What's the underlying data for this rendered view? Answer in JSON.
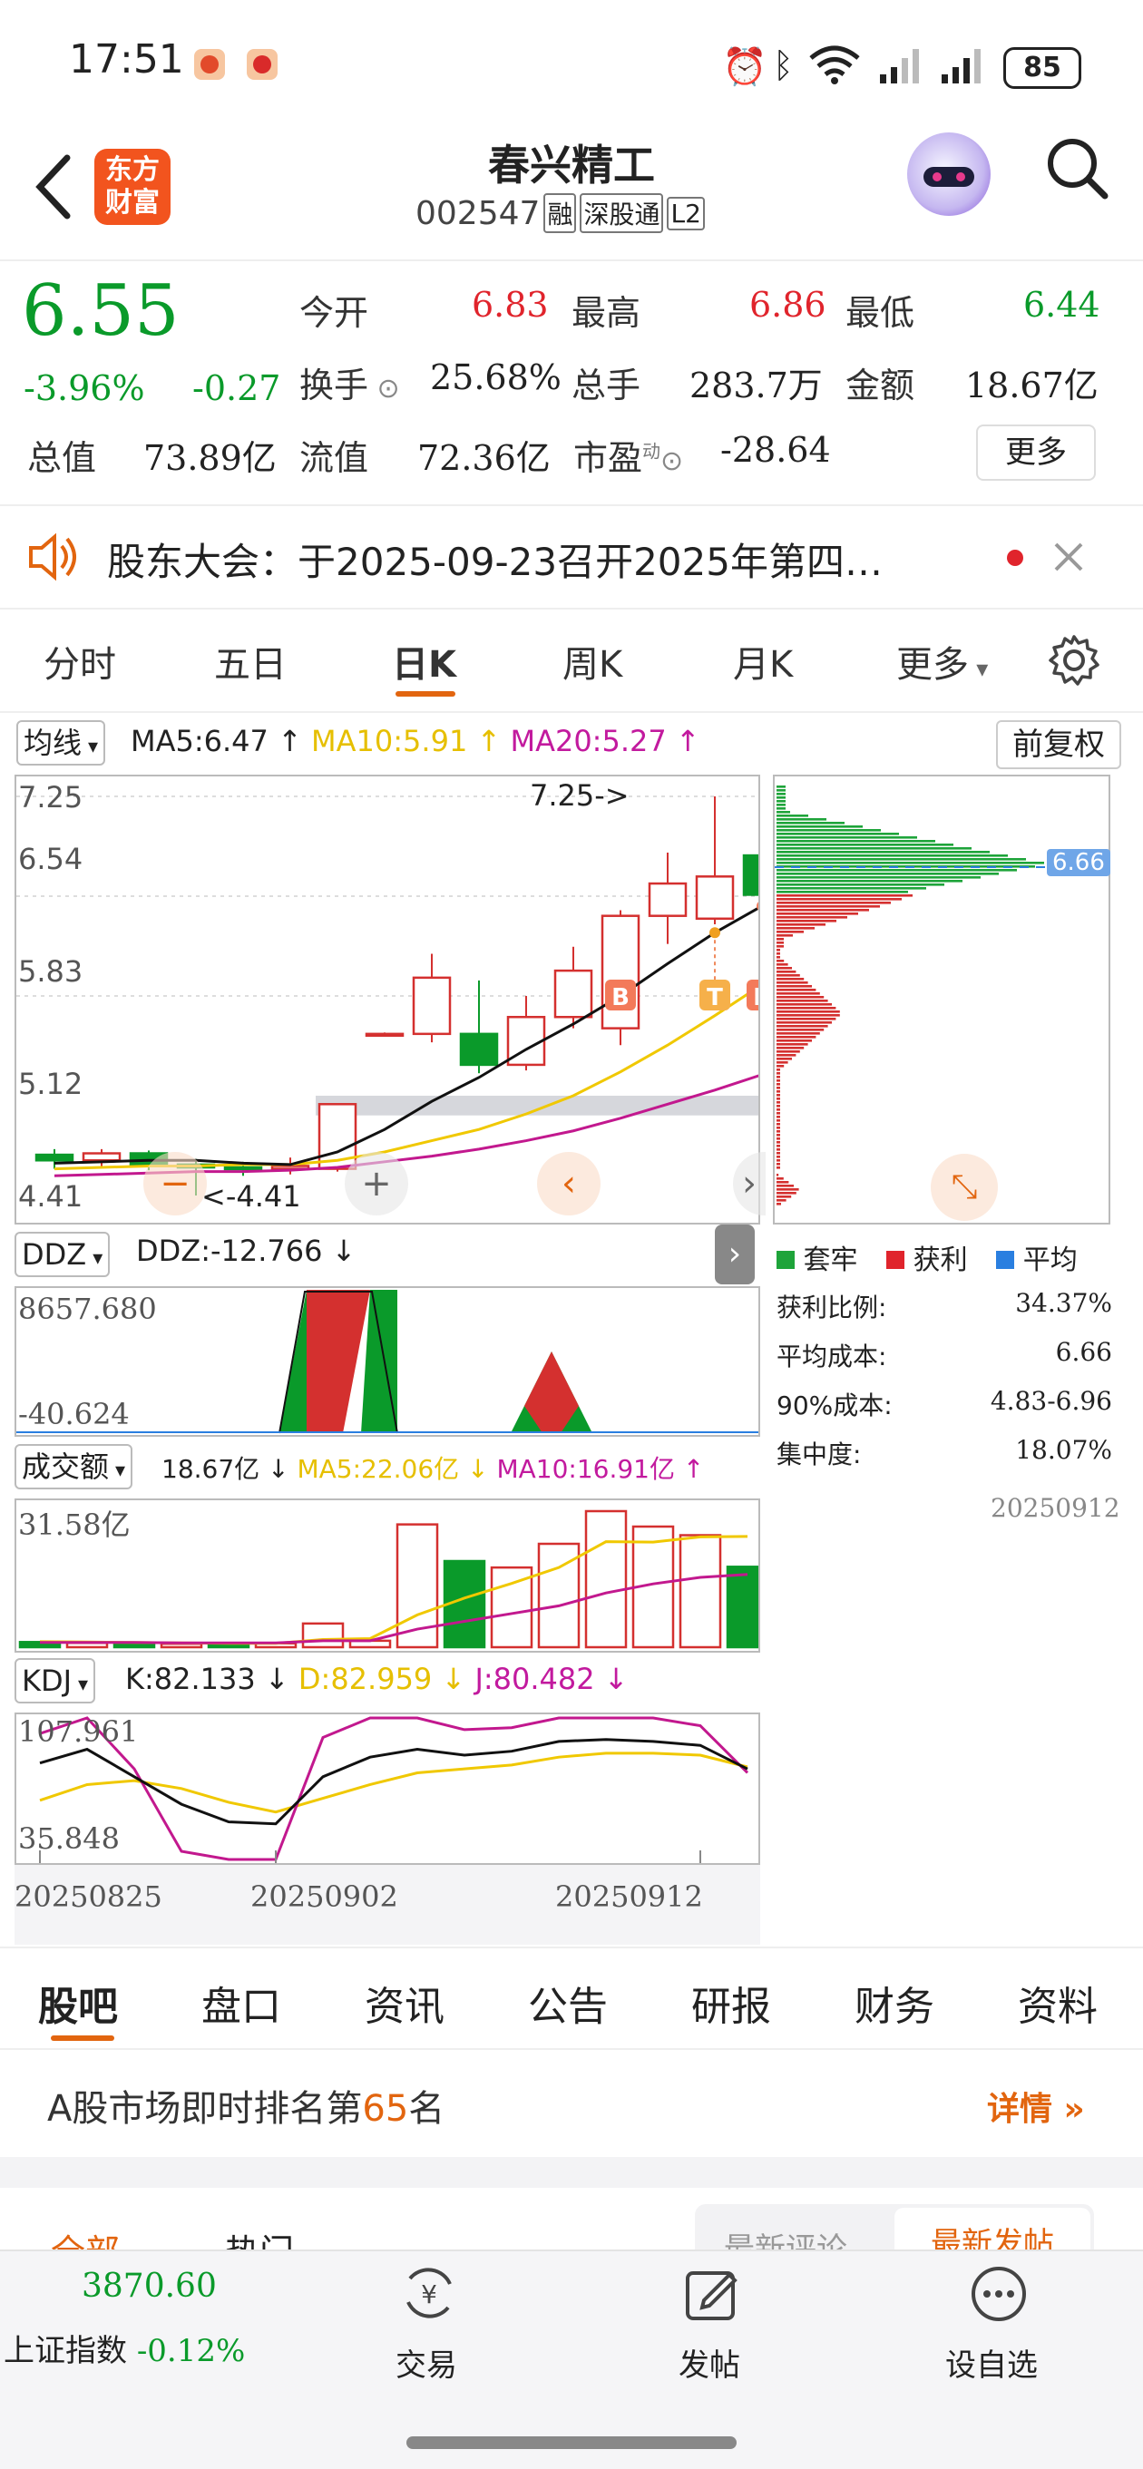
{
  "status_bar": {
    "time": "17:51",
    "battery": "85"
  },
  "header": {
    "title": "春兴精工",
    "code": "002547",
    "badges": [
      "融",
      "深股通",
      "L2"
    ],
    "brand_logo": "东方\n财富"
  },
  "quote": {
    "price": "6.55",
    "change_pct": "-3.96%",
    "change": "-0.27",
    "stats": [
      {
        "label": "今开",
        "value": "6.83",
        "color": "#e0242c"
      },
      {
        "label": "最高",
        "value": "6.86",
        "color": "#e0242c"
      },
      {
        "label": "最低",
        "value": "6.44",
        "color": "#0a9a2a"
      },
      {
        "label": "换手",
        "value": "25.68%",
        "color": "#222222"
      },
      {
        "label": "总手",
        "value": "283.7万",
        "color": "#222222"
      },
      {
        "label": "金额",
        "value": "18.67亿",
        "color": "#222222"
      },
      {
        "label": "总值",
        "value": "73.89亿",
        "color": "#222222"
      },
      {
        "label": "流值",
        "value": "72.36亿",
        "color": "#222222"
      },
      {
        "label": "市盈",
        "value": "-28.64",
        "color": "#222222"
      }
    ],
    "pe_sup": "动",
    "more_button": "更多"
  },
  "notice": {
    "text": "股东大会：于2025-09-23召开2025年第四…"
  },
  "kline_tabs": {
    "items": [
      "分时",
      "五日",
      "日K",
      "周K",
      "月K",
      "更多"
    ],
    "active": 2
  },
  "ma_bar": {
    "selector": "均线",
    "ma5": "MA5:6.47",
    "ma10": "MA10:5.91",
    "ma20": "MA20:5.27",
    "adjust_button": "前复权"
  },
  "chart_data": [
    {
      "type": "candlestick",
      "title": "",
      "ylim": [
        4.41,
        7.25
      ],
      "y_ticks": [
        "7.25",
        "6.54",
        "5.83",
        "5.12",
        "4.41"
      ],
      "annotations": {
        "high": "7.25->",
        "low": "<-4.41"
      },
      "candles": [
        {
          "o": 4.7,
          "h": 4.74,
          "l": 4.6,
          "c": 4.66
        },
        {
          "o": 4.66,
          "h": 4.74,
          "l": 4.62,
          "c": 4.71
        },
        {
          "o": 4.71,
          "h": 4.73,
          "l": 4.59,
          "c": 4.63
        },
        {
          "o": 4.63,
          "h": 4.67,
          "l": 4.41,
          "c": 4.61
        },
        {
          "o": 4.61,
          "h": 4.65,
          "l": 4.55,
          "c": 4.6
        },
        {
          "o": 4.6,
          "h": 4.68,
          "l": 4.56,
          "c": 4.62
        },
        {
          "o": 4.6,
          "h": 5.06,
          "l": 4.58,
          "c": 5.06
        },
        {
          "o": 5.56,
          "h": 5.57,
          "l": 5.56,
          "c": 5.56
        },
        {
          "o": 5.56,
          "h": 6.13,
          "l": 5.5,
          "c": 5.96
        },
        {
          "o": 5.56,
          "h": 5.94,
          "l": 5.28,
          "c": 5.34
        },
        {
          "o": 5.34,
          "h": 5.83,
          "l": 5.3,
          "c": 5.68
        },
        {
          "o": 5.68,
          "h": 6.18,
          "l": 5.6,
          "c": 6.01
        },
        {
          "o": 5.6,
          "h": 6.44,
          "l": 5.48,
          "c": 6.4
        },
        {
          "o": 6.4,
          "h": 6.85,
          "l": 6.2,
          "c": 6.63
        },
        {
          "o": 6.38,
          "h": 7.25,
          "l": 6.34,
          "c": 6.68
        },
        {
          "o": 6.83,
          "h": 6.86,
          "l": 6.44,
          "c": 6.55
        }
      ],
      "ma5": [
        4.64,
        4.65,
        4.66,
        4.66,
        4.64,
        4.63,
        4.72,
        4.88,
        5.08,
        5.25,
        5.45,
        5.63,
        5.83,
        6.06,
        6.28,
        6.47
      ],
      "ma10": [
        4.6,
        4.61,
        4.62,
        4.62,
        4.63,
        4.63,
        4.66,
        4.72,
        4.8,
        4.88,
        4.99,
        5.12,
        5.29,
        5.48,
        5.69,
        5.91
      ],
      "ma20": [
        4.55,
        4.56,
        4.57,
        4.58,
        4.58,
        4.59,
        4.61,
        4.65,
        4.69,
        4.74,
        4.8,
        4.87,
        4.96,
        5.06,
        5.16,
        5.27
      ],
      "markers": [
        {
          "index": 12,
          "label": "B"
        },
        {
          "index": 14,
          "label": "T"
        },
        {
          "index": 15,
          "label": "B"
        }
      ]
    },
    {
      "type": "area",
      "title": "",
      "ylim": [
        -40.624,
        8657.68
      ],
      "y_ticks": [
        "8657.680",
        "-40.624"
      ],
      "indicator": "DDZ",
      "value": "DDZ:-12.766"
    },
    {
      "type": "bar",
      "title": "",
      "y_ticks": [
        "31.58亿"
      ],
      "ylim": [
        0,
        31.58
      ],
      "indicator": "成交额",
      "value": "18.67亿",
      "ma5": "MA5:22.06亿",
      "ma10": "MA10:16.91亿",
      "values": [
        1.2,
        1.0,
        0.9,
        0.8,
        0.8,
        0.9,
        5.5,
        1.5,
        28.5,
        20.0,
        18.5,
        24.0,
        31.58,
        28.0,
        26.0,
        18.67
      ],
      "up": [
        false,
        true,
        false,
        true,
        false,
        true,
        true,
        true,
        true,
        false,
        true,
        true,
        true,
        true,
        true,
        false
      ],
      "ma5_line": [
        1.3,
        1.2,
        1.1,
        1.0,
        0.9,
        0.9,
        1.8,
        2.0,
        7.5,
        11.4,
        14.8,
        18.5,
        24.5,
        24.4,
        25.6,
        25.7
      ],
      "ma10_line": [
        1.1,
        1.1,
        1.1,
        1.0,
        1.0,
        1.0,
        1.5,
        1.5,
        4.2,
        6.0,
        7.8,
        9.6,
        12.6,
        14.7,
        16.2,
        16.9
      ]
    },
    {
      "type": "line",
      "title": "",
      "ylim": [
        35.848,
        107.961
      ],
      "y_ticks": [
        "107.961",
        "35.848"
      ],
      "indicator": "KDJ",
      "k_text": "K:82.133",
      "d_text": "D:82.959",
      "j_text": "J:80.482",
      "x_labels": [
        "20250825",
        "20250902",
        "20250912"
      ],
      "k": [
        85,
        92,
        78,
        64,
        55,
        54,
        78,
        88,
        92,
        89,
        91,
        96,
        97,
        96,
        94,
        82
      ],
      "d": [
        66,
        74,
        76,
        72,
        65,
        60,
        67,
        74,
        80,
        82,
        84,
        88,
        90,
        90,
        89,
        83
      ],
      "j": [
        100,
        108,
        82,
        40,
        30,
        30,
        98,
        112,
        116,
        102,
        103,
        112,
        112,
        108,
        104,
        80
      ]
    }
  ],
  "chip": {
    "price_tag": "6.66",
    "legend": [
      "套牢",
      "获利",
      "平均"
    ],
    "rows": [
      {
        "label": "获利比例:",
        "value": "34.37%"
      },
      {
        "label": "平均成本:",
        "value": "6.66"
      },
      {
        "label": "90%成本:",
        "value": "4.83-6.96"
      },
      {
        "label": "集中度:",
        "value": "18.07%"
      }
    ],
    "date": "20250912"
  },
  "bottom_tabs": {
    "items": [
      "股吧",
      "盘口",
      "资讯",
      "公告",
      "研报",
      "财务",
      "资料"
    ],
    "active": 0
  },
  "rank": {
    "prefix": "A股市场即时排名第",
    "number": "65",
    "suffix": "名",
    "link": "详情"
  },
  "sub_tabs": {
    "left": [
      "全部",
      "热门"
    ],
    "right": [
      "最新评论",
      "最新发帖"
    ]
  },
  "nav": {
    "index_value": "3870.60",
    "index_name": "上证指数",
    "index_change": "-0.12%",
    "items": [
      "交易",
      "发帖",
      "设自选"
    ]
  },
  "colors": {
    "up": "#d4302f",
    "down": "#0a9a2a",
    "ma5": "#111111",
    "ma10": "#f0c800",
    "ma20": "#c2188e",
    "accent": "#e2650f"
  }
}
